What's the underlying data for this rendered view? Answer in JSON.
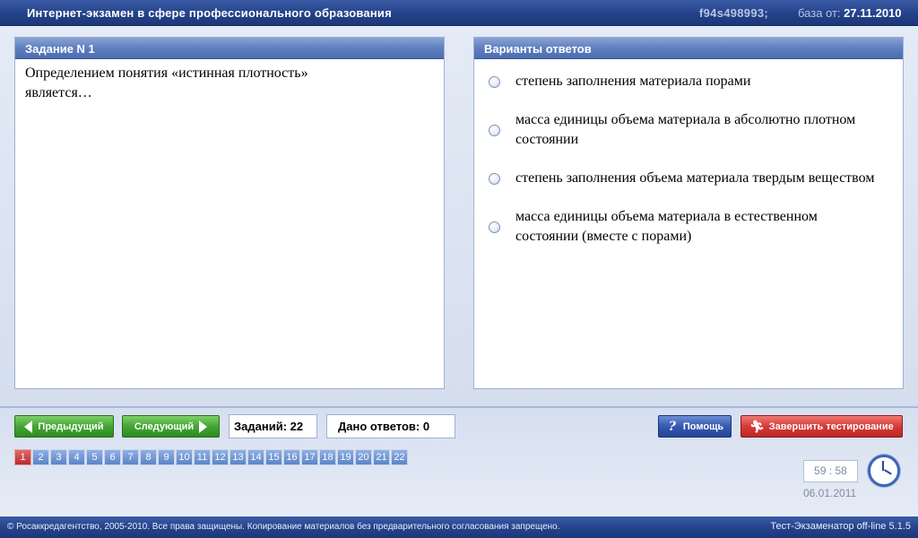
{
  "header": {
    "title": "Интернет-экзамен в сфере профессионального образования",
    "session_id": "f94s498993;",
    "base_label": "база от:",
    "base_date": "27.11.2010"
  },
  "question_panel": {
    "title": "Задание N 1",
    "text_line1": "Определением понятия «истинная плотность»",
    "text_line2": "является…"
  },
  "answers_panel": {
    "title": "Варианты ответов",
    "options": [
      {
        "text": "степень заполнения материала порами"
      },
      {
        "text": "масса единицы объема материала в абсолютно плотном состоянии"
      },
      {
        "text": "степень заполнения объема материала твердым веществом"
      },
      {
        "text": "масса единицы объема материала в естественном состоянии (вместе с порами)"
      }
    ]
  },
  "toolbar": {
    "prev_label": "Предыдущий",
    "next_label": "Следующий",
    "tasks_count": "Заданий: 22",
    "answers_given": "Дано ответов: 0",
    "help_label": "Помощь",
    "finish_label": "Завершить тестирование",
    "active_question": "1",
    "questions": [
      "1",
      "2",
      "3",
      "4",
      "5",
      "6",
      "7",
      "8",
      "9",
      "10",
      "11",
      "12",
      "13",
      "14",
      "15",
      "16",
      "17",
      "18",
      "19",
      "20",
      "21",
      "22"
    ],
    "timer": "59 : 58",
    "date": "06.01.2011"
  },
  "footer": {
    "copyright": "© Росаккредагентство, 2005-2010. Все права защищены. Копирование материалов без предварительного согласования запрещено.",
    "version": "Тест-Экзаменатор off-line 5.1.5"
  },
  "colors": {
    "header_bg": "#24428a",
    "panel_header": "#5f7fbf",
    "green_button": "#44a634",
    "blue_button": "#3559ad",
    "red_button": "#d63b36",
    "active_question": "#b82b2b"
  },
  "icons": [
    "arrow-left-icon",
    "arrow-right-icon",
    "help-icon",
    "running-man-icon",
    "clock-icon",
    "radio-icon"
  ]
}
